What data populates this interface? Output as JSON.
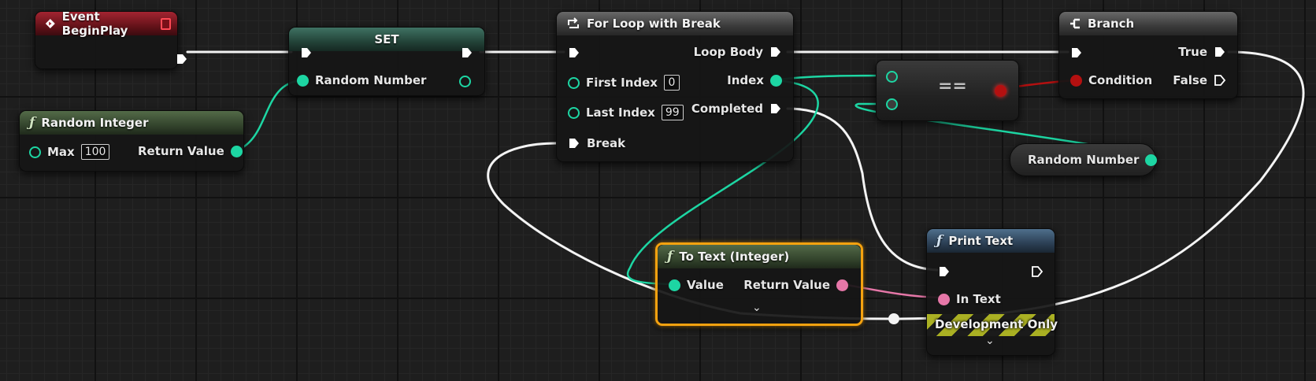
{
  "nodes": {
    "event_begin_play": {
      "title": "Event BeginPlay"
    },
    "set": {
      "title": "SET",
      "pin_label": "Random Number"
    },
    "random_integer": {
      "title": "Random Integer",
      "max_label": "Max",
      "max_value": "100",
      "return_label": "Return Value"
    },
    "for_loop": {
      "title": "For Loop with Break",
      "loop_body": "Loop Body",
      "first_index_label": "First Index",
      "first_index_value": "0",
      "index_label": "Index",
      "last_index_label": "Last Index",
      "last_index_value": "99",
      "completed_label": "Completed",
      "break_label": "Break"
    },
    "equal": {
      "title": "=="
    },
    "random_number_var": {
      "label": "Random Number"
    },
    "branch": {
      "title": "Branch",
      "true_label": "True",
      "condition_label": "Condition",
      "false_label": "False"
    },
    "to_text": {
      "title": "To Text (Integer)",
      "value_label": "Value",
      "return_label": "Return Value"
    },
    "print_text": {
      "title": "Print Text",
      "in_text_label": "In Text",
      "dev_only_label": "Development Only"
    }
  },
  "colors": {
    "exec_wire": "#f4f4f4",
    "int_pin": "#1dd6a3",
    "bool_pin": "#b41010",
    "text_pin": "#e677a8",
    "event_header": "#a32431",
    "function_header": "#536a48",
    "selection_outline": "#f5a20f"
  },
  "icons": {
    "event": "diamond-arrow-icon",
    "function": "function-f-icon",
    "loop": "loop-arrow-icon",
    "branch": "branch-icon",
    "expand": "chevron-down-icon"
  }
}
